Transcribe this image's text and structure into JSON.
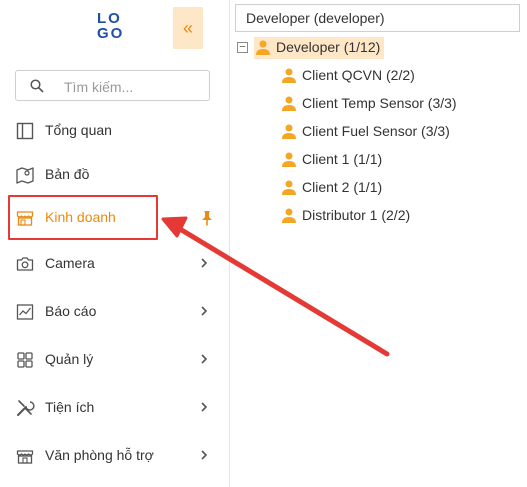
{
  "logo": {
    "line1": "LO",
    "line2": "GO"
  },
  "collapse_glyph": "«",
  "search": {
    "placeholder": "Tìm kiếm..."
  },
  "menu": [
    {
      "label": "Tổng quan",
      "icon": "dashboard-icon"
    },
    {
      "label": "Bản đồ",
      "icon": "map-icon"
    },
    {
      "label": "Kinh doanh",
      "icon": "store-icon",
      "active": true
    },
    {
      "label": "Camera",
      "icon": "camera-icon"
    },
    {
      "label": "Báo cáo",
      "icon": "chart-icon"
    },
    {
      "label": "Quản lý",
      "icon": "grid-icon"
    },
    {
      "label": "Tiện ích",
      "icon": "tools-icon"
    },
    {
      "label": "Văn phòng hỗ trợ",
      "icon": "office-icon"
    }
  ],
  "developer_select": "Developer (developer)",
  "tree": {
    "root": "Developer (1/12)",
    "children": [
      "Client QCVN (2/2)",
      "Client Temp Sensor (3/3)",
      "Client Fuel Sensor (3/3)",
      "Client 1 (1/1)",
      "Client 2 (1/1)",
      "Distributor 1 (2/2)"
    ]
  },
  "colors": {
    "accent": "#e98a12",
    "highlight": "#e53935",
    "brand": "#1f4fa8",
    "tree_icon": "#f5a623"
  }
}
